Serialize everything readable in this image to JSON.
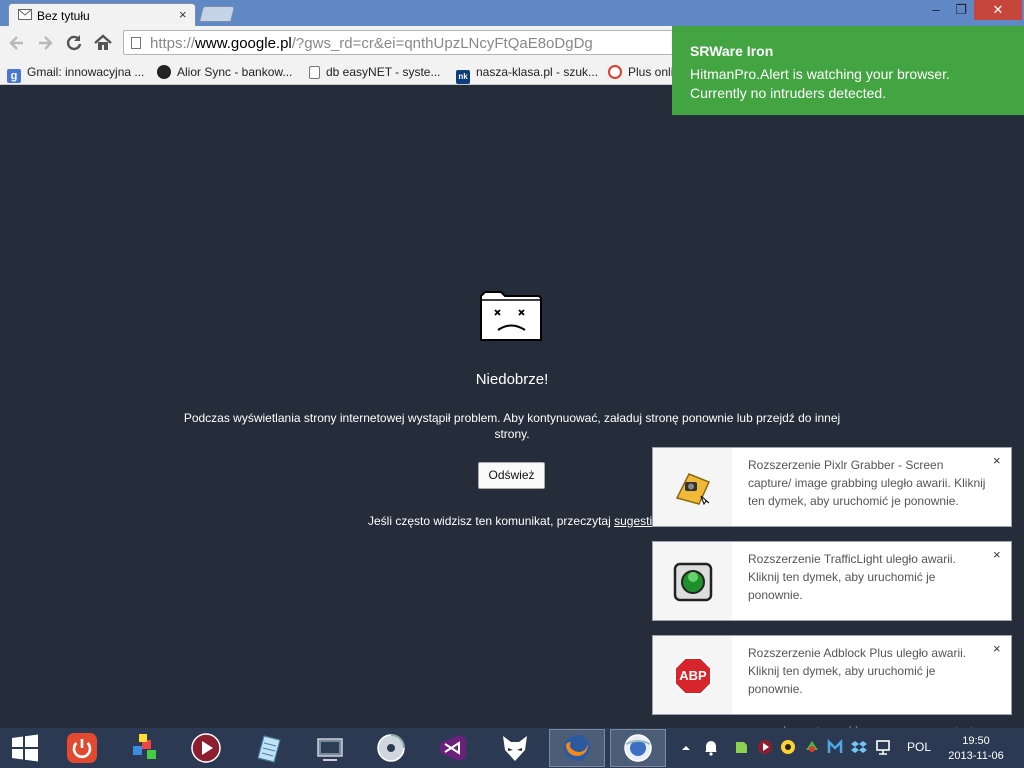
{
  "browser": {
    "tab_title": "Bez tytułu",
    "tab_close": "×",
    "window_buttons": {
      "minimize": "–",
      "restore": "❐",
      "close": "✕"
    },
    "url_prefix": "https://",
    "url_host": "www.google.pl",
    "url_rest": "/?gws_rd=cr&ei=qnthUpzLNcyFtQaE8oDgDg"
  },
  "bookmarks": [
    {
      "label": "Gmail: innowacyjna ...",
      "icon": "google-icon",
      "color": "#4a77d4"
    },
    {
      "label": "Alior Sync - bankow...",
      "icon": "alior-icon",
      "color": "#222222"
    },
    {
      "label": "db easyNET - syste...",
      "icon": "page-icon",
      "color": "#ffffff"
    },
    {
      "label": "nasza-klasa.pl - szuk...",
      "icon": "nk-icon",
      "color": "#0d3d7a"
    },
    {
      "label": "Plus onli",
      "icon": "plus-icon",
      "color": "#e23a2d"
    }
  ],
  "crash_page": {
    "title": "Niedobrze!",
    "message": "Podczas wyświetlania strony internetowej wystąpił problem. Aby kontynuować, załaduj stronę ponownie lub przejdź do innej strony.",
    "reload_label": "Odśwież",
    "help_text": "Jeśli często widzisz ten komunikat, przeczytaj ",
    "help_link": "sugestie"
  },
  "notifications": {
    "iron": {
      "title": "SRWare Iron",
      "line1": "HitmanPro.Alert is watching your browser.",
      "line2": "Currently no intruders detected.",
      "color": "#43a541"
    },
    "extensions": [
      {
        "name": "pixlr",
        "message": "Rozszerzenie Pixlr Grabber - Screen capture/ image grabbing uległo awarii. Kliknij ten dymek, aby uruchomić je ponownie.",
        "close": "×"
      },
      {
        "name": "trafficlight",
        "message": "Rozszerzenie TrafficLight uległo awarii. Kliknij ten dymek, aby uruchomić je ponownie.",
        "close": "×"
      },
      {
        "name": "adblock",
        "message": "Rozszerzenie Adblock Plus uległo awarii. Kliknij ten dymek, aby uruchomić je ponownie.",
        "close": "×",
        "icon_text": "ABP"
      }
    ]
  },
  "taskbar": {
    "language": "POL",
    "time": "19:50",
    "date": "2013-11-06",
    "watermark": "bestwallpapers.net.tc"
  }
}
